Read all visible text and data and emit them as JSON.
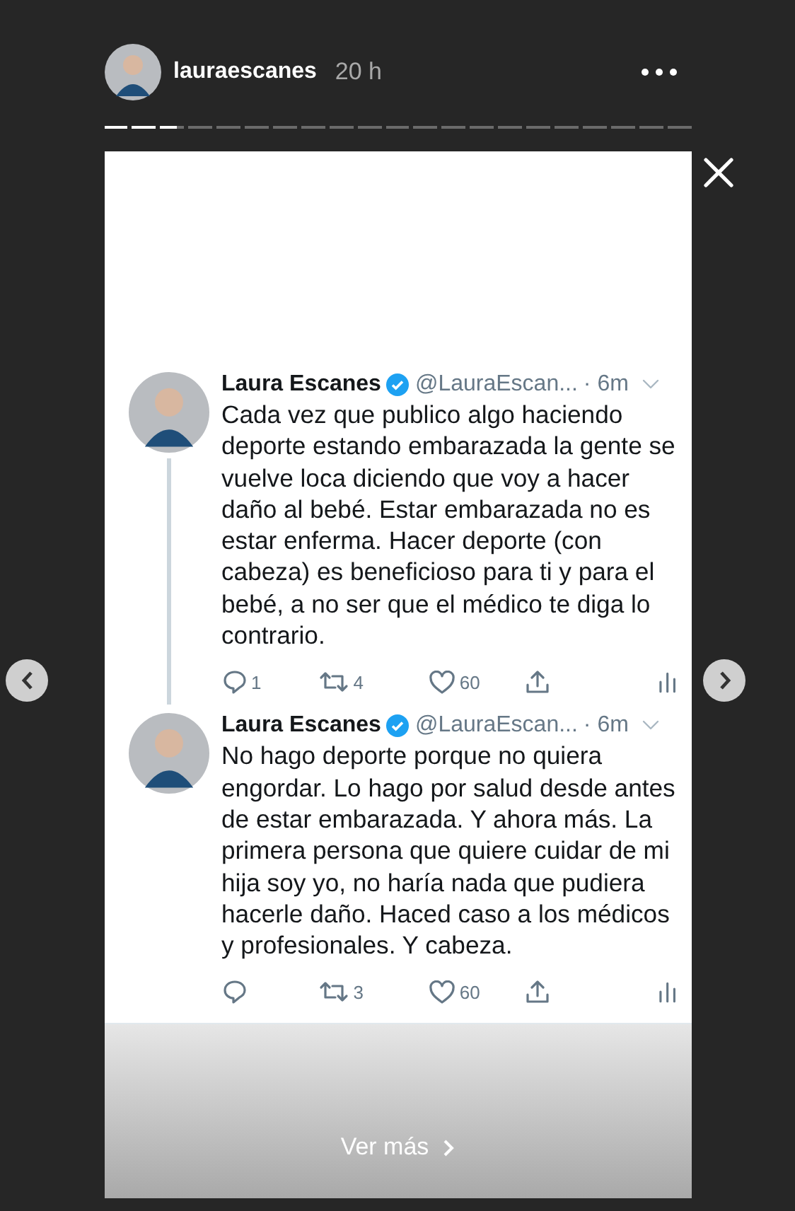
{
  "story": {
    "username": "lauraescanes",
    "time": "20 h"
  },
  "progress": [
    {
      "seen": true,
      "selected": false
    },
    {
      "seen": true,
      "selected": false
    },
    {
      "seen": false,
      "selected": true
    },
    {
      "seen": false,
      "selected": false
    },
    {
      "seen": false,
      "selected": false
    },
    {
      "seen": false,
      "selected": false
    },
    {
      "seen": false,
      "selected": false
    },
    {
      "seen": false,
      "selected": false
    },
    {
      "seen": false,
      "selected": false
    },
    {
      "seen": false,
      "selected": false
    },
    {
      "seen": false,
      "selected": false
    },
    {
      "seen": false,
      "selected": false
    },
    {
      "seen": false,
      "selected": false
    },
    {
      "seen": false,
      "selected": false
    },
    {
      "seen": false,
      "selected": false
    },
    {
      "seen": false,
      "selected": false
    },
    {
      "seen": false,
      "selected": false
    },
    {
      "seen": false,
      "selected": false
    },
    {
      "seen": false,
      "selected": false
    },
    {
      "seen": false,
      "selected": false
    },
    {
      "seen": false,
      "selected": false
    }
  ],
  "tweets": [
    {
      "name": "Laura Escanes",
      "verified": true,
      "handle": "@LauraEscan...",
      "time": "· 6m",
      "text": "Cada vez que publico algo haciendo deporte estando embarazada la gente se vuelve loca diciendo que voy a hacer daño al bebé. Estar embarazada no es estar enferma. Hacer deporte (con cabeza) es beneficioso para ti y para el bebé, a no ser que el médico te diga lo contrario.",
      "replies": "1",
      "retweets": "4",
      "likes": "60",
      "thread_continues": true
    },
    {
      "name": "Laura Escanes",
      "verified": true,
      "handle": "@LauraEscan...",
      "time": "· 6m",
      "text": "No hago deporte porque no quiera engordar. Lo hago por salud desde antes de estar embarazada. Y ahora más. La primera persona que quiere cuidar de mi hija soy yo, no haría nada que pudiera hacerle daño. Haced caso a los médicos y profesionales. Y cabeza.",
      "retweets": "3",
      "likes": "60",
      "thread_continues": false
    }
  ],
  "see_more": {
    "label": "Ver más"
  }
}
